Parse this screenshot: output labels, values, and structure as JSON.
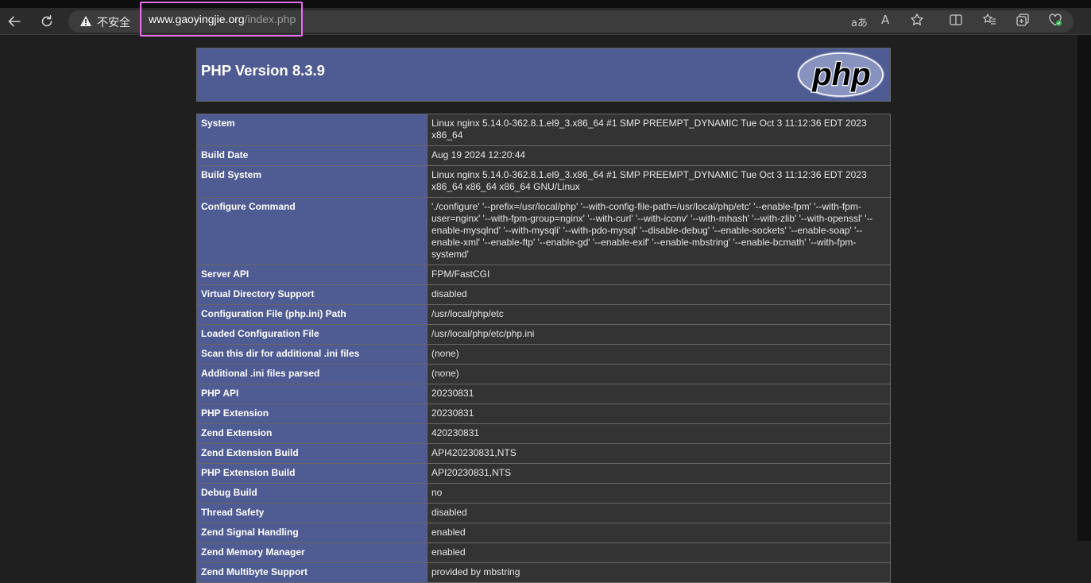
{
  "browser": {
    "insecure_label": "不安全",
    "url_host": "www.gaoyingjie.org",
    "url_path": "/index.php",
    "icons": [
      "back-arrow-icon",
      "refresh-icon",
      "warning-icon",
      "translate-icon",
      "read-aloud-icon",
      "favorite-star-icon",
      "split-screen-icon",
      "favorites-icon",
      "collections-icon",
      "browser-essentials-icon"
    ],
    "translate_glyph": "aあ",
    "read_aloud_glyph": "A"
  },
  "phpinfo": {
    "title": "PHP Version 8.3.9",
    "logo_text": "php",
    "rows": [
      {
        "key": "System",
        "value": "Linux nginx 5.14.0-362.8.1.el9_3.x86_64 #1 SMP PREEMPT_DYNAMIC Tue Oct 3 11:12:36 EDT 2023 x86_64"
      },
      {
        "key": "Build Date",
        "value": "Aug 19 2024 12:20:44"
      },
      {
        "key": "Build System",
        "value": "Linux nginx 5.14.0-362.8.1.el9_3.x86_64 #1 SMP PREEMPT_DYNAMIC Tue Oct 3 11:12:36 EDT 2023 x86_64 x86_64 x86_64 GNU/Linux"
      },
      {
        "key": "Configure Command",
        "value": "'./configure' '--prefix=/usr/local/php' '--with-config-file-path=/usr/local/php/etc' '--enable-fpm' '--with-fpm-user=nginx' '--with-fpm-group=nginx' '--with-curl' '--with-iconv' '--with-mhash' '--with-zlib' '--with-openssl' '--enable-mysqlnd' '--with-mysqli' '--with-pdo-mysql' '--disable-debug' '--enable-sockets' '--enable-soap' '--enable-xml' '--enable-ftp' '--enable-gd' '--enable-exif' '--enable-mbstring' '--enable-bcmath' '--with-fpm-systemd'"
      },
      {
        "key": "Server API",
        "value": "FPM/FastCGI"
      },
      {
        "key": "Virtual Directory Support",
        "value": "disabled"
      },
      {
        "key": "Configuration File (php.ini) Path",
        "value": "/usr/local/php/etc"
      },
      {
        "key": "Loaded Configuration File",
        "value": "/usr/local/php/etc/php.ini"
      },
      {
        "key": "Scan this dir for additional .ini files",
        "value": "(none)"
      },
      {
        "key": "Additional .ini files parsed",
        "value": "(none)"
      },
      {
        "key": "PHP API",
        "value": "20230831"
      },
      {
        "key": "PHP Extension",
        "value": "20230831"
      },
      {
        "key": "Zend Extension",
        "value": "420230831"
      },
      {
        "key": "Zend Extension Build",
        "value": "API420230831,NTS"
      },
      {
        "key": "PHP Extension Build",
        "value": "API20230831,NTS"
      },
      {
        "key": "Debug Build",
        "value": "no"
      },
      {
        "key": "Thread Safety",
        "value": "disabled"
      },
      {
        "key": "Zend Signal Handling",
        "value": "enabled"
      },
      {
        "key": "Zend Memory Manager",
        "value": "enabled"
      },
      {
        "key": "Zend Multibyte Support",
        "value": "provided by mbstring"
      }
    ]
  },
  "colors": {
    "header_bg": "#4f5b93",
    "value_bg": "#333333",
    "url_highlight": "#e86ef0",
    "page_bg": "#1f1f1f"
  }
}
